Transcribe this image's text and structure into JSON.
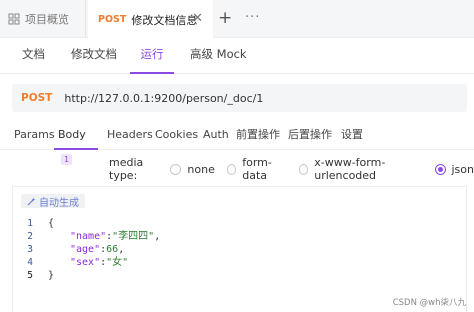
{
  "top_tabs": {
    "overview_label": "项目概览",
    "active_method": "POST",
    "active_label": "修改文档信息",
    "close": "✕",
    "add": "+",
    "more": "···"
  },
  "sub_tabs": [
    "文档",
    "修改文档",
    "运行",
    "高级 Mock"
  ],
  "url_bar": {
    "method": "POST",
    "url": "http://127.0.0.1:9200/person/_doc/1"
  },
  "param_tabs": {
    "params": "Params",
    "body": "Body",
    "body_count": "1",
    "headers": "Headers",
    "cookies": "Cookies",
    "auth": "Auth",
    "pre": "前置操作",
    "post": "后置操作",
    "settings": "设置"
  },
  "media": {
    "label": "media type:",
    "options": [
      "none",
      "form-data",
      "x-www-form-urlencoded",
      "json"
    ],
    "selected": "json"
  },
  "editor": {
    "auto_generate": "自动生成",
    "line_numbers": [
      "1",
      "2",
      "3",
      "4",
      "5"
    ],
    "lines": {
      "l1": "{",
      "l2_key": "\"name\"",
      "l2_val": "\"李四四\"",
      "l3_key": "\"age\"",
      "l3_val": "66",
      "l4_key": "\"sex\"",
      "l4_val": "\"女\"",
      "l5": "}"
    }
  },
  "watermark": "CSDN @wh柒八九",
  "colors": {
    "accent": "#8a4be0",
    "method": "#f07c2e"
  }
}
